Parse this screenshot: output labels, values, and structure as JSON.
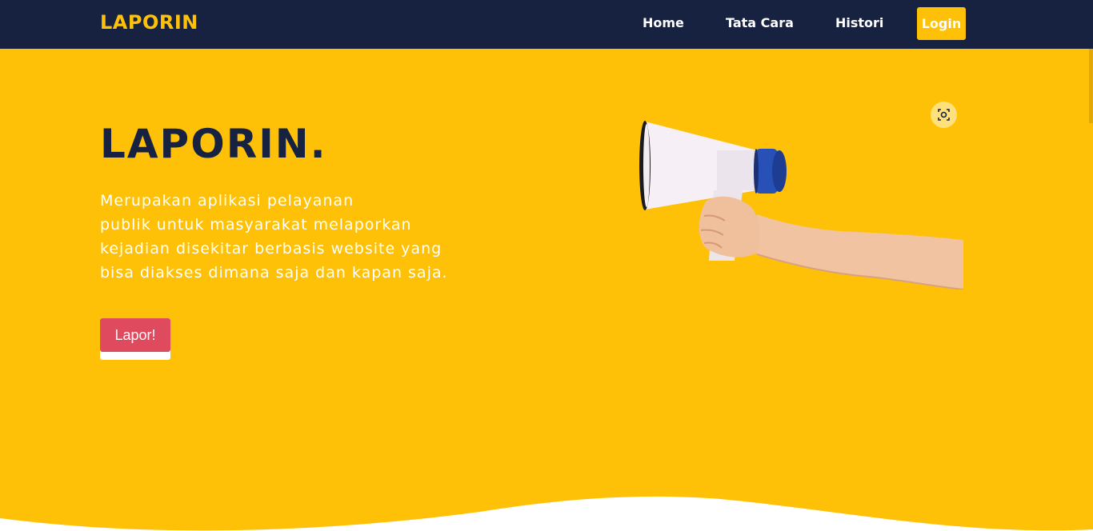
{
  "navbar": {
    "brand": "LAPORIN",
    "links": [
      "Home",
      "Tata Cara",
      "Histori"
    ],
    "login_label": "Login"
  },
  "hero": {
    "title": "LAPORIN.",
    "description_lines": [
      "Merupakan aplikasi pelayanan",
      "publik untuk masyarakat melaporkan",
      "kejadian disekitar berbasis website yang",
      "bisa diakses dimana saja dan kapan saja."
    ],
    "cta_label": "Lapor!",
    "image_icon": "megaphone-in-hand",
    "lens_icon": "visual-search-icon"
  },
  "colors": {
    "navbar_bg": "#172140",
    "accent_yellow": "#ffc107",
    "cta_red": "#e04a5f",
    "text_dark": "#172140",
    "text_light": "#ffffff"
  }
}
